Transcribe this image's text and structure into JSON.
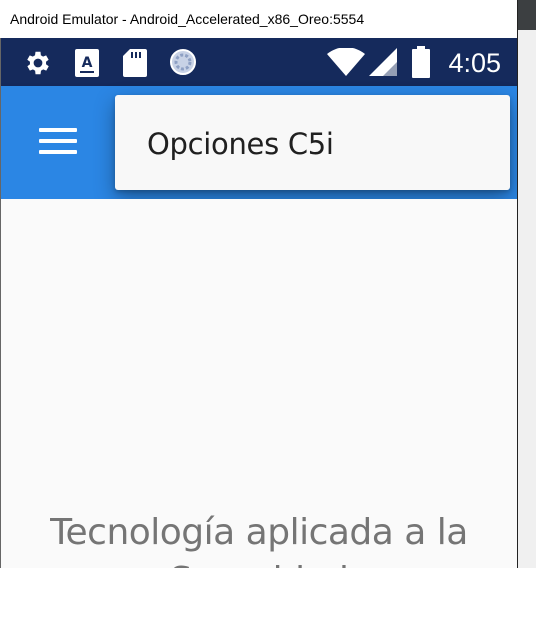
{
  "window": {
    "title": "Android Emulator - Android_Accelerated_x86_Oreo:5554"
  },
  "status_bar": {
    "time": "4:05",
    "icons": [
      "settings-icon",
      "keyboard-a-icon",
      "sd-card-icon",
      "sync-spinner-icon",
      "wifi-icon",
      "cell-signal-icon",
      "battery-icon"
    ],
    "background_color": "#152a5c"
  },
  "app_bar": {
    "color": "#2b86e4",
    "menu_icon": "hamburger-menu-icon"
  },
  "popup_menu": {
    "items": [
      {
        "label": "Opciones C5i"
      }
    ]
  },
  "content": {
    "tagline": "Tecnología aplicada a la Seguridad"
  }
}
